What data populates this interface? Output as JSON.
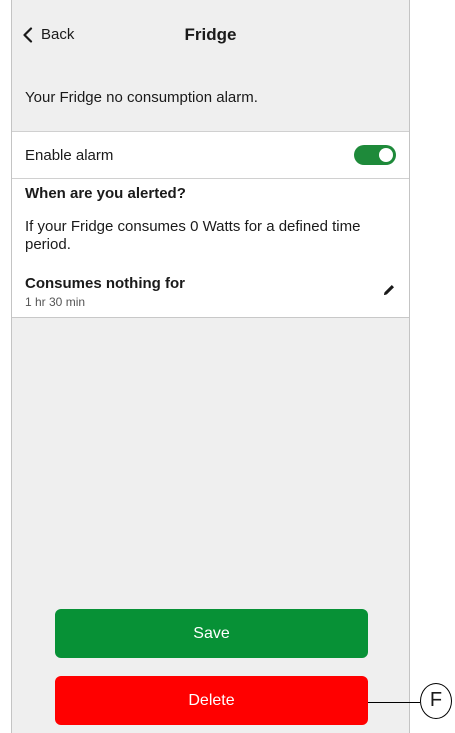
{
  "header": {
    "back_label": "Back",
    "title": "Fridge"
  },
  "intro_text": "Your Fridge no consumption alarm.",
  "enable_alarm": {
    "label": "Enable alarm",
    "enabled": true
  },
  "alert_info": {
    "heading": "When are you alerted?",
    "description": "If your Fridge consumes 0 Watts for a defined time period.",
    "consumes_nothing": {
      "title": "Consumes nothing for",
      "value": "1 hr 30 min"
    }
  },
  "actions": {
    "save_label": "Save",
    "delete_label": "Delete"
  },
  "callout": {
    "label": "F"
  },
  "colors": {
    "toggle_on": "#1e8a3a",
    "save": "#079136",
    "delete": "#ff0000",
    "background": "#efefef"
  },
  "icons": {
    "back": "chevron-left-icon",
    "edit": "pencil-icon"
  }
}
